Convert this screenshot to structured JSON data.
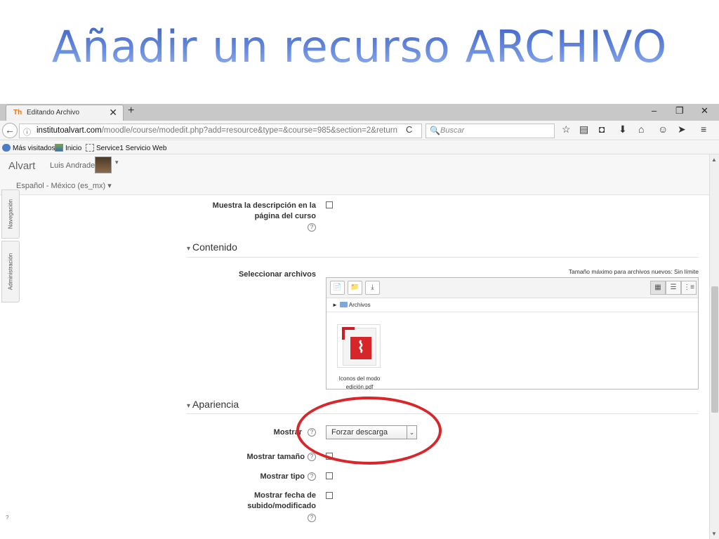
{
  "slide": {
    "title": "Añadir un recurso ARCHIVO"
  },
  "browser": {
    "tab_favicon": "Th",
    "tab_title": "Editando Archivo",
    "tab_close": "✕",
    "new_tab": "+",
    "window_controls": {
      "minimize": "–",
      "restore": "❐",
      "close": "✕"
    },
    "url_host": "institutoalvart.com",
    "url_path": "/moodle/course/modedit.php?add=resource&type=&course=985&section=2&return",
    "search_placeholder": "Buscar",
    "icons": {
      "back": "←",
      "info": "ⓘ",
      "reload": "C",
      "search": "🔍",
      "star": "☆",
      "reading_list": "▤",
      "pocket": "◘",
      "download": "⬇",
      "home": "⌂",
      "smiley": "☺",
      "send": "➤",
      "menu": "≡"
    },
    "bookmarks": [
      "Más visitados",
      "Inicio",
      "Service1 Servicio Web"
    ]
  },
  "moodle": {
    "brand": "Alvart",
    "user_name": "Luis Andrade",
    "user_caret": "▾",
    "language": "Español - México (es_mx) ▾",
    "side_tabs": [
      "Navegación",
      "Administración"
    ],
    "form": {
      "show_description_label_1": "Muestra la descripción en la",
      "show_description_label_2": "página del curso",
      "help": "?",
      "section_content": "Contenido",
      "section_triangle": "▾",
      "select_files_label": "Seleccionar archivos",
      "max_size": "Tamaño máximo para archivos nuevos: Sin límite",
      "path_arrow": "►",
      "folder": "Archivos",
      "file_name": "Iconos del modo edición.pdf",
      "section_appearance": "Apariencia",
      "display_label": "Mostrar",
      "display_value": "Forzar descarga",
      "select_caret": "⌄",
      "show_size_label": "Mostrar tamaño",
      "show_type_label": "Mostrar tipo",
      "show_date_label_1": "Mostrar fecha de",
      "show_date_label_2": "subido/modificado"
    },
    "filepicker_icons": {
      "add_file": "📄",
      "new_folder": "📁",
      "download_all": "⤓",
      "view_icons": "▦",
      "view_list": "☰",
      "view_tree": "⋮≡"
    },
    "scroll": {
      "up": "▲",
      "down": "▼"
    },
    "corner": "?"
  },
  "colors": {
    "title_blue": "#4a6fd0",
    "annotation_red": "#d8262a",
    "pdf_red": "#d7262a"
  }
}
